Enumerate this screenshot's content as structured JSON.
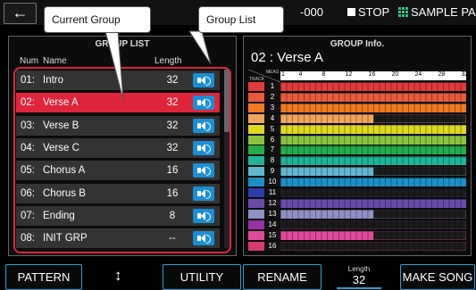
{
  "topbar": {
    "back_glyph": "←",
    "status_text": "-000",
    "stop_label": "STOP",
    "sample_pad_label": "SAMPLE PAD",
    "stop_icon": "stop-square-icon",
    "pad_icon": "grid-pad-icon"
  },
  "left_panel": {
    "title": "GROUP LIST",
    "col_num": "Num",
    "col_name": "Name",
    "col_length": "Length",
    "rows": [
      {
        "num": "01:",
        "name": "Intro",
        "length": "32"
      },
      {
        "num": "02:",
        "name": "Verse A",
        "length": "32"
      },
      {
        "num": "03:",
        "name": "Verse B",
        "length": "32"
      },
      {
        "num": "04:",
        "name": "Verse C",
        "length": "32"
      },
      {
        "num": "05:",
        "name": "Chorus A",
        "length": "16"
      },
      {
        "num": "06:",
        "name": "Chorus B",
        "length": "16"
      },
      {
        "num": "07:",
        "name": "Ending",
        "length": "8"
      },
      {
        "num": "08:",
        "name": "INIT GRP",
        "length": "--"
      }
    ],
    "selected_row_color": "#e0253a",
    "speaker_icon": "speaker-icon"
  },
  "right_panel": {
    "title": "GROUP Info.",
    "group_name": "02 : Verse A",
    "meas_label": "MEAS",
    "track_label": "TRACK",
    "meas_ticks": [
      "1",
      "4",
      "8",
      "12",
      "16",
      "20",
      "24",
      "28",
      "32"
    ],
    "tracks": [
      {
        "num": "1",
        "color": "#e23a3a",
        "filled": 1.0
      },
      {
        "num": "2",
        "color": "#ea5a3e",
        "filled": 1.0
      },
      {
        "num": "3",
        "color": "#f07a20",
        "filled": 1.0
      },
      {
        "num": "4",
        "color": "#f2a55a",
        "filled": 0.5
      },
      {
        "num": "5",
        "color": "#e0d820",
        "filled": 1.0
      },
      {
        "num": "6",
        "color": "#8ac43e",
        "filled": 1.0
      },
      {
        "num": "7",
        "color": "#24ad4a",
        "filled": 1.0
      },
      {
        "num": "8",
        "color": "#1fb59a",
        "filled": 1.0
      },
      {
        "num": "9",
        "color": "#63b6cf",
        "filled": 0.5
      },
      {
        "num": "10",
        "color": "#1a8fc8",
        "filled": 1.0
      },
      {
        "num": "11",
        "color": "#2a3fa8",
        "filled": 0.0
      },
      {
        "num": "12",
        "color": "#6a4aa8",
        "filled": 1.0
      },
      {
        "num": "13",
        "color": "#9090c8",
        "filled": 0.5
      },
      {
        "num": "14",
        "color": "#9a2fa8",
        "filled": 0.0
      },
      {
        "num": "15",
        "color": "#e04a9a",
        "filled": 0.5
      },
      {
        "num": "16",
        "color": "#d83a6a",
        "filled": 0.0
      }
    ]
  },
  "bottom": {
    "pattern_label": "PATTERN",
    "updown_glyph": "↕",
    "utility_label": "UTILITY",
    "rename_label": "RENAME",
    "length_label": "Length",
    "length_value": "32",
    "make_song_label": "MAKE SONG",
    "accent_color": "#2a9fd6"
  },
  "callouts": {
    "current_group": "Current Group",
    "group_list": "Group List"
  }
}
